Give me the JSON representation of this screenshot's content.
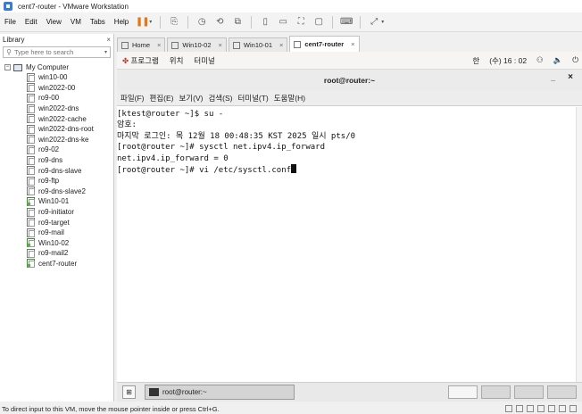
{
  "window": {
    "title": "cent7-router - VMware Workstation"
  },
  "menu": [
    "File",
    "Edit",
    "View",
    "VM",
    "Tabs",
    "Help"
  ],
  "library": {
    "header": "Library",
    "close": "×",
    "search_placeholder": "Type here to search",
    "root": "My Computer",
    "items": [
      {
        "label": "win10-00",
        "running": false
      },
      {
        "label": "win2022-00",
        "running": false
      },
      {
        "label": "ro9-00",
        "running": false
      },
      {
        "label": "win2022-dns",
        "running": false
      },
      {
        "label": "win2022-cache",
        "running": false
      },
      {
        "label": "win2022-dns-root",
        "running": false
      },
      {
        "label": "win2022-dns-ke",
        "running": false
      },
      {
        "label": "ro9-02",
        "running": false
      },
      {
        "label": "ro9-dns",
        "running": false
      },
      {
        "label": "ro9-dns-slave",
        "running": false
      },
      {
        "label": "ro9-ftp",
        "running": false
      },
      {
        "label": "ro9-dns-slave2",
        "running": false
      },
      {
        "label": "Win10-01",
        "running": true
      },
      {
        "label": "ro9-initiator",
        "running": false
      },
      {
        "label": "ro9-target",
        "running": false
      },
      {
        "label": "ro9-mail",
        "running": false
      },
      {
        "label": "Win10-02",
        "running": true
      },
      {
        "label": "ro9-mail2",
        "running": false
      },
      {
        "label": "cent7-router",
        "running": true
      }
    ]
  },
  "tabs": [
    {
      "label": "Home",
      "active": false
    },
    {
      "label": "Win10-02",
      "active": false
    },
    {
      "label": "Win10-01",
      "active": false
    },
    {
      "label": "cent7-router",
      "active": true
    }
  ],
  "gnome_top": {
    "apps": "프로그램",
    "places": "위치",
    "terminal": "터미널",
    "ime": "한",
    "clock": "(수) 16 : 02"
  },
  "terminal": {
    "title": "root@router:~",
    "menu": [
      "파일(F)",
      "편집(E)",
      "보기(V)",
      "검색(S)",
      "터미널(T)",
      "도움말(H)"
    ],
    "lines": [
      "[ktest@router ~]$ su -",
      "암호:",
      "마지막 로그인: 목 12월 18 00:48:35 KST 2025 일시 pts/0",
      "[root@router ~]# sysctl net.ipv4.ip_forward",
      "net.ipv4.ip_forward = 0",
      "[root@router ~]# vi /etc/sysctl.conf"
    ]
  },
  "gnome_bottom": {
    "task_label": "root@router:~"
  },
  "status": {
    "message": "To direct input to this VM, move the mouse pointer inside or press Ctrl+G."
  }
}
